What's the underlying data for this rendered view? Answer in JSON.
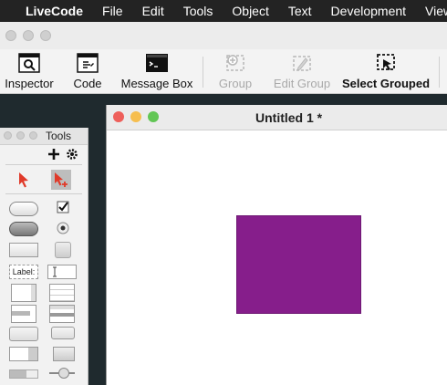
{
  "menubar": {
    "app_name": "LiveCode",
    "items": [
      "File",
      "Edit",
      "Tools",
      "Object",
      "Text",
      "Development",
      "View"
    ]
  },
  "toolbar": {
    "inspector": "Inspector",
    "code": "Code",
    "message_box": "Message Box",
    "group": "Group",
    "edit_group": "Edit Group",
    "select_grouped": "Select Grouped"
  },
  "tools_palette": {
    "title": "Tools",
    "label_tool_text": "Label:"
  },
  "document": {
    "title": "Untitled 1 *",
    "shape_color": "#861e8b"
  },
  "colors": {
    "close": "#ee5f5a",
    "minimize": "#f6be4f",
    "zoom": "#62c655",
    "menubar_bg": "#232323",
    "canvas_bg": "#1f2a2e"
  }
}
